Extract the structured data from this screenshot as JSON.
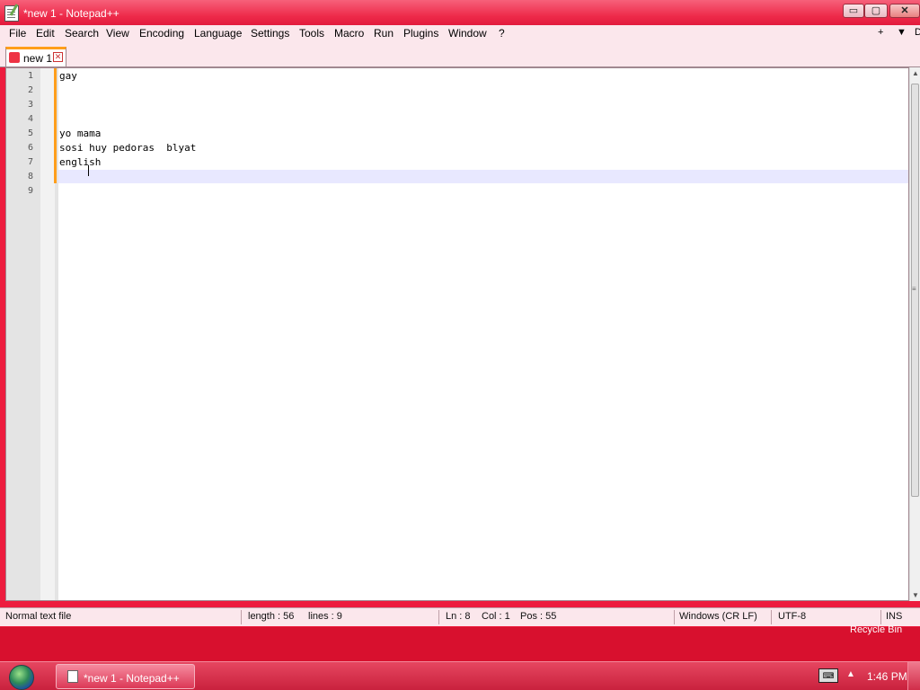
{
  "window": {
    "title": "*new 1 - Notepad++",
    "controls": {
      "minimize": "▭",
      "maximize": "▢",
      "close": "✕"
    }
  },
  "menu": {
    "items": [
      "File",
      "Edit",
      "Search",
      "View",
      "Encoding",
      "Language",
      "Settings",
      "Tools",
      "Macro",
      "Run",
      "Plugins",
      "Window",
      "?"
    ],
    "right": {
      "plus": "+",
      "dropdown": "▼",
      "restore": "D"
    }
  },
  "tabs": [
    {
      "label": "new 1",
      "close": "✕",
      "modified": true
    }
  ],
  "editor": {
    "line_numbers": [
      "1",
      "2",
      "3",
      "4",
      "5",
      "6",
      "7",
      "8",
      "9"
    ],
    "lines": [
      "gay",
      "",
      "",
      "",
      "yo mama",
      "sosi huy pedoras  blyat",
      "english",
      "",
      ""
    ],
    "current_line": 8
  },
  "status": {
    "file_type": "Normal text file",
    "length": "length : 56",
    "lines": "lines : 9",
    "ln": "Ln : 8",
    "col": "Col : 1",
    "pos": "Pos : 55",
    "eol": "Windows (CR LF)",
    "encoding": "UTF-8",
    "mode": "INS"
  },
  "desktop": {
    "recycle_bin": "Recycle Bin"
  },
  "taskbar": {
    "window_label": "*new 1 - Notepad++",
    "tray_arrow": "▲",
    "clock": "1:46 PM"
  },
  "colors": {
    "accent": "#ed1c3e",
    "chrome": "#fbe7ec",
    "change_marker": "#ff9e1b",
    "current_line": "#e8e8ff"
  }
}
